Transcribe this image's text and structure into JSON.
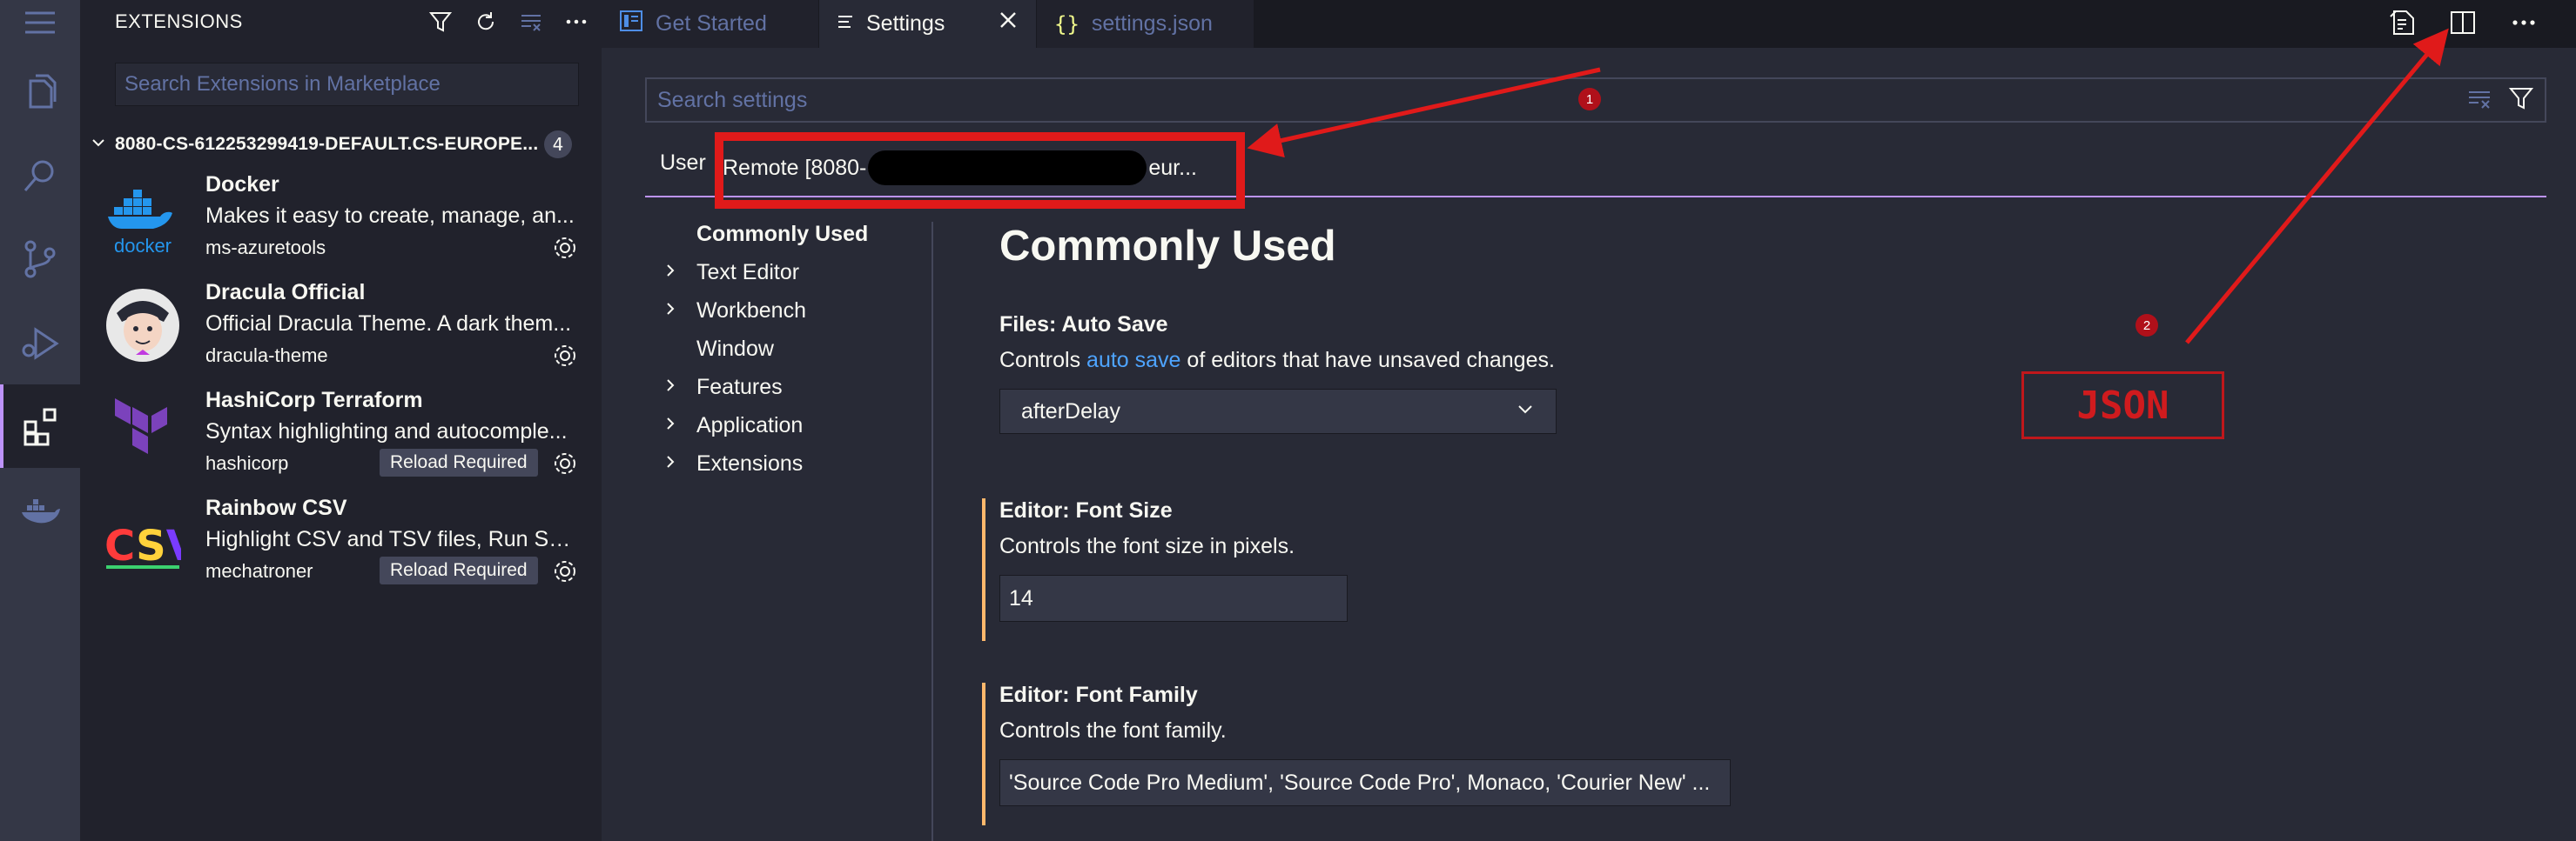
{
  "activity_bar": {
    "items": [
      "menu-icon",
      "explorer-icon",
      "search-icon",
      "source-control-icon",
      "run-debug-icon",
      "extensions-icon",
      "docker-icon"
    ]
  },
  "sidebar": {
    "title": "EXTENSIONS",
    "search_placeholder": "Search Extensions in Marketplace",
    "group": {
      "name": "8080-CS-612253299419-DEFAULT.CS-EUROPE...",
      "count": "4"
    },
    "extensions": [
      {
        "name": "Docker",
        "description": "Makes it easy to create, manage, an...",
        "publisher": "ms-azuretools",
        "badge": ""
      },
      {
        "name": "Dracula Official",
        "description": "Official Dracula Theme. A dark them...",
        "publisher": "dracula-theme",
        "badge": ""
      },
      {
        "name": "HashiCorp Terraform",
        "description": "Syntax highlighting and autocomple...",
        "publisher": "hashicorp",
        "badge": "Reload Required"
      },
      {
        "name": "Rainbow CSV",
        "description": "Highlight CSV and TSV files, Run SQ...",
        "publisher": "mechatroner",
        "badge": "Reload Required"
      }
    ]
  },
  "tabs": [
    {
      "label": "Get Started",
      "icon": "get-started-icon",
      "state": "inactive"
    },
    {
      "label": "Settings",
      "icon": "settings-lines-icon",
      "state": "active"
    },
    {
      "label": "settings.json",
      "icon": "json-braces-icon",
      "state": "inactive"
    }
  ],
  "settings": {
    "search_placeholder": "Search settings",
    "scope_user": "User",
    "scope_remote_prefix": "Remote [8080-",
    "scope_remote_suffix": "eur...",
    "toc": [
      {
        "label": "Commonly Used",
        "expandable": false,
        "active": true
      },
      {
        "label": "Text Editor",
        "expandable": true
      },
      {
        "label": "Workbench",
        "expandable": true
      },
      {
        "label": "Window",
        "expandable": false
      },
      {
        "label": "Features",
        "expandable": true
      },
      {
        "label": "Application",
        "expandable": true
      },
      {
        "label": "Extensions",
        "expandable": true
      }
    ],
    "section_title": "Commonly Used",
    "auto_save": {
      "label": "Files: Auto Save",
      "desc_before": "Controls ",
      "desc_link": "auto save",
      "desc_after": " of editors that have unsaved changes.",
      "value": "afterDelay"
    },
    "font_size": {
      "label": "Editor: Font Size",
      "desc": "Controls the font size in pixels.",
      "value": "14"
    },
    "font_family": {
      "label": "Editor: Font Family",
      "desc": "Controls the font family.",
      "value": "'Source Code Pro Medium', 'Source Code Pro', Monaco, 'Courier New' ..."
    }
  },
  "annotations": {
    "marker_1": "1",
    "marker_2": "2",
    "json_label": "JSON",
    "color": "#e01a1a"
  },
  "colors": {
    "background": "#282a36",
    "sidebar": "#21222c",
    "activity_bar": "#343746",
    "accent": "#bd93f9",
    "modified": "#ffb86c",
    "link": "#4ea4ff"
  }
}
